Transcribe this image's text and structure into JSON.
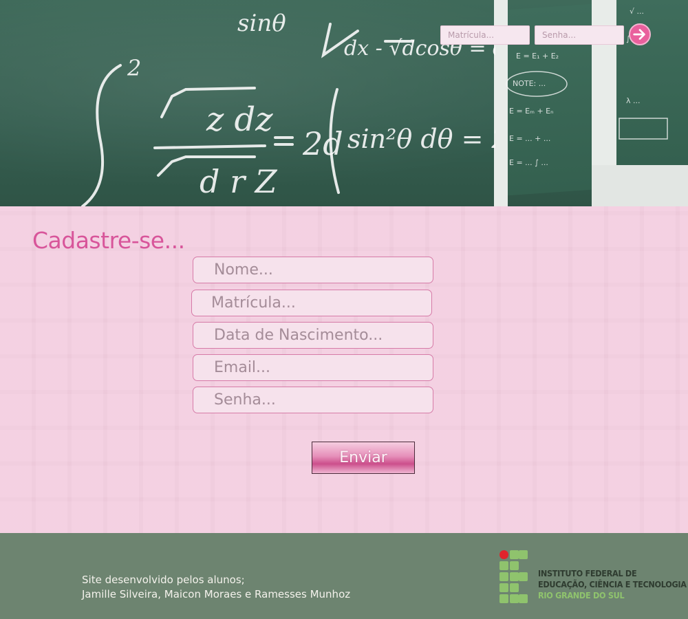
{
  "header": {
    "login": {
      "matricula_placeholder": "Matrícula...",
      "senha_placeholder": "Senha...",
      "submit_icon": "arrow-right-icon"
    }
  },
  "main": {
    "title": "Cadastre-se...",
    "form": {
      "nome_placeholder": "Nome...",
      "matricula_placeholder": "Matrícula...",
      "nascimento_placeholder": "Data de Nascimento...",
      "email_placeholder": "Email...",
      "senha_placeholder": "Senha...",
      "submit_label": "Enviar"
    }
  },
  "footer": {
    "credits_line1": "Site desenvolvido pelos alunos;",
    "credits_line2": "Jamille Silveira, Maicon Moraes e Ramesses Munhoz",
    "logo": {
      "line1": "INSTITUTO FEDERAL DE",
      "line2": "EDUCAÇÃO, CIÊNCIA E TECNOLOGIA",
      "line3": "RIO GRANDE DO SUL"
    }
  },
  "colors": {
    "accent": "#d8559a",
    "background": "#f3cde0",
    "footer": "#6d8470",
    "logo_green": "#8fc36d",
    "logo_red": "#e0232c"
  }
}
